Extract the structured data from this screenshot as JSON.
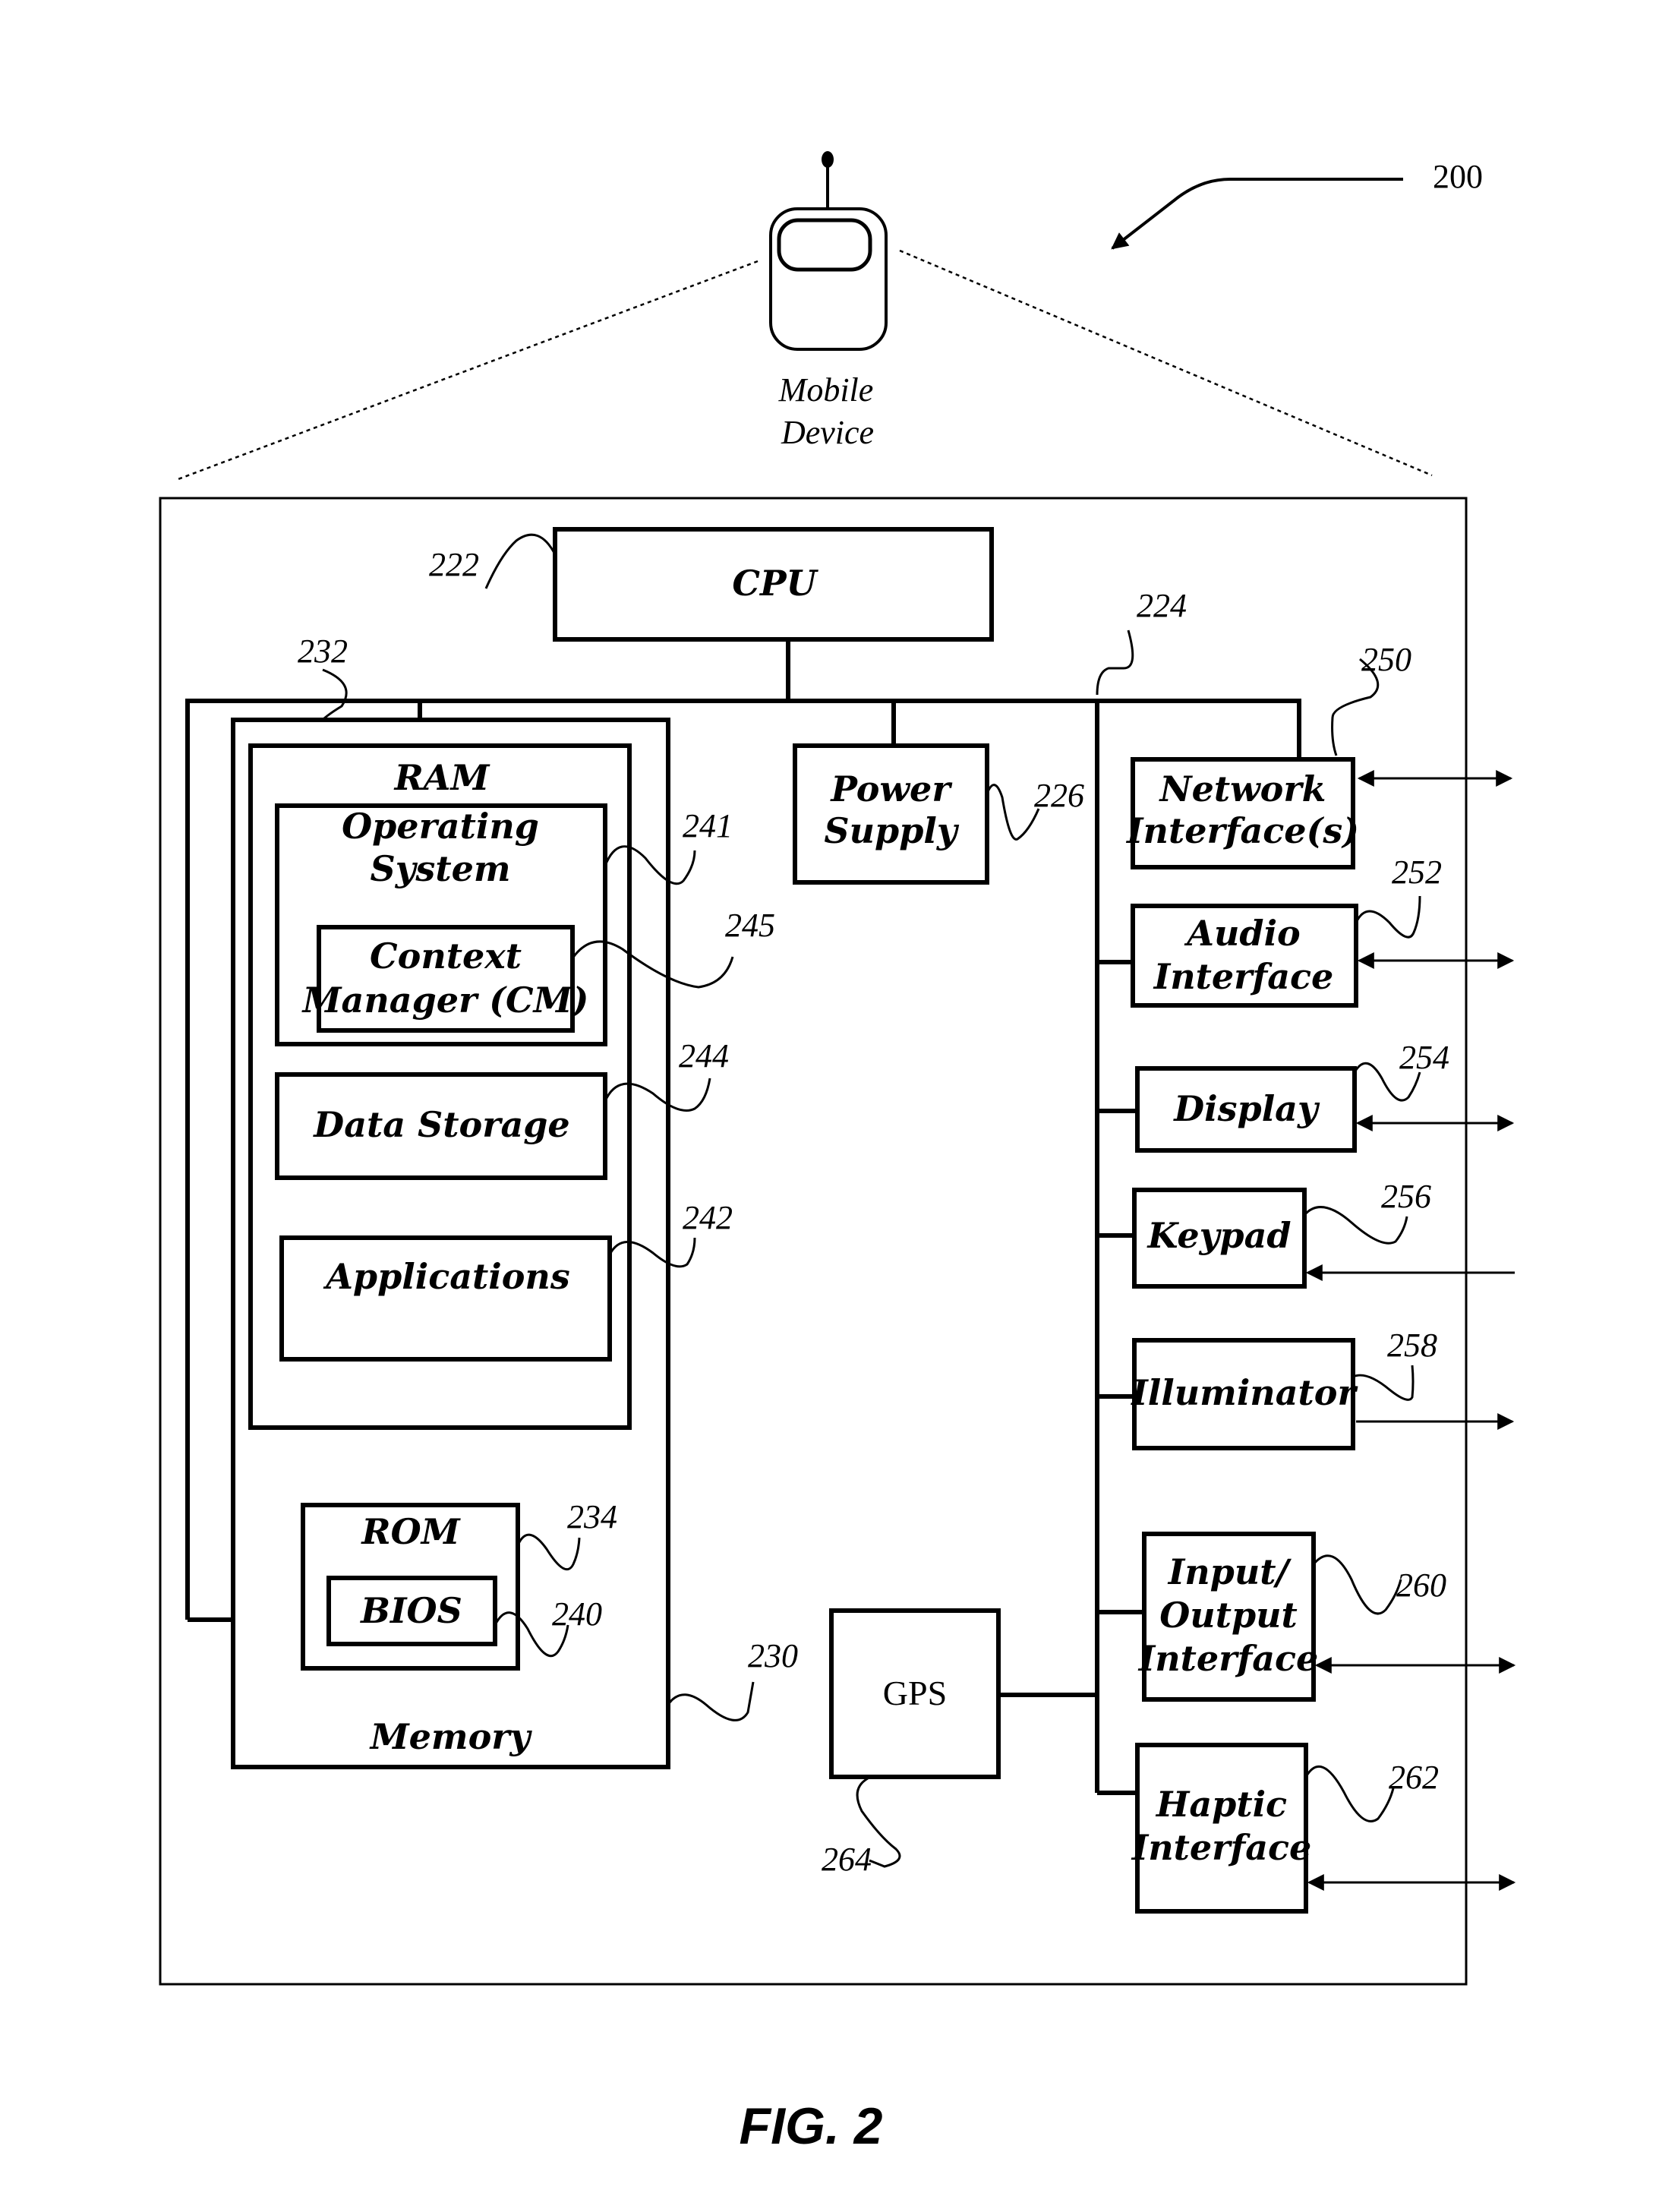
{
  "figure": {
    "reference_number": "200",
    "caption": "FIG. 2",
    "device_label_line1": "Mobile",
    "device_label_line2": "Device",
    "device_icon": "mobile-phone-icon"
  },
  "components": {
    "cpu": {
      "label": "CPU",
      "ref": "222"
    },
    "bus": {
      "ref": "224"
    },
    "power_supply": {
      "label_line1": "Power",
      "label_line2": "Supply",
      "ref": "226"
    },
    "memory": {
      "label": "Memory",
      "ref": "230"
    },
    "ram": {
      "label": "RAM",
      "ref": "232"
    },
    "rom": {
      "label": "ROM",
      "ref": "234"
    },
    "bios": {
      "label": "BIOS",
      "ref": "240"
    },
    "operating_system": {
      "label_line1": "Operating",
      "label_line2": "System",
      "ref": "241"
    },
    "applications": {
      "label": "Applications",
      "ref": "242"
    },
    "data_storage": {
      "label": "Data Storage",
      "ref": "244"
    },
    "context_manager": {
      "label_line1": "Context",
      "label_line2": "Manager (CM)",
      "ref": "245"
    },
    "network_interface": {
      "label_line1": "Network",
      "label_line2": "Interface(s)",
      "ref": "250",
      "io": "bidirectional"
    },
    "audio_interface": {
      "label_line1": "Audio",
      "label_line2": "Interface",
      "ref": "252",
      "io": "bidirectional"
    },
    "display": {
      "label": "Display",
      "ref": "254",
      "io": "bidirectional"
    },
    "keypad": {
      "label": "Keypad",
      "ref": "256",
      "io": "input"
    },
    "illuminator": {
      "label": "Illuminator",
      "ref": "258",
      "io": "output"
    },
    "io_interface": {
      "label_line1": "Input/",
      "label_line2": "Output",
      "label_line3": "Interface",
      "ref": "260",
      "io": "bidirectional"
    },
    "haptic_interface": {
      "label_line1": "Haptic",
      "label_line2": "Interface",
      "ref": "262",
      "io": "bidirectional"
    },
    "gps": {
      "label": "GPS",
      "ref": "264"
    }
  }
}
